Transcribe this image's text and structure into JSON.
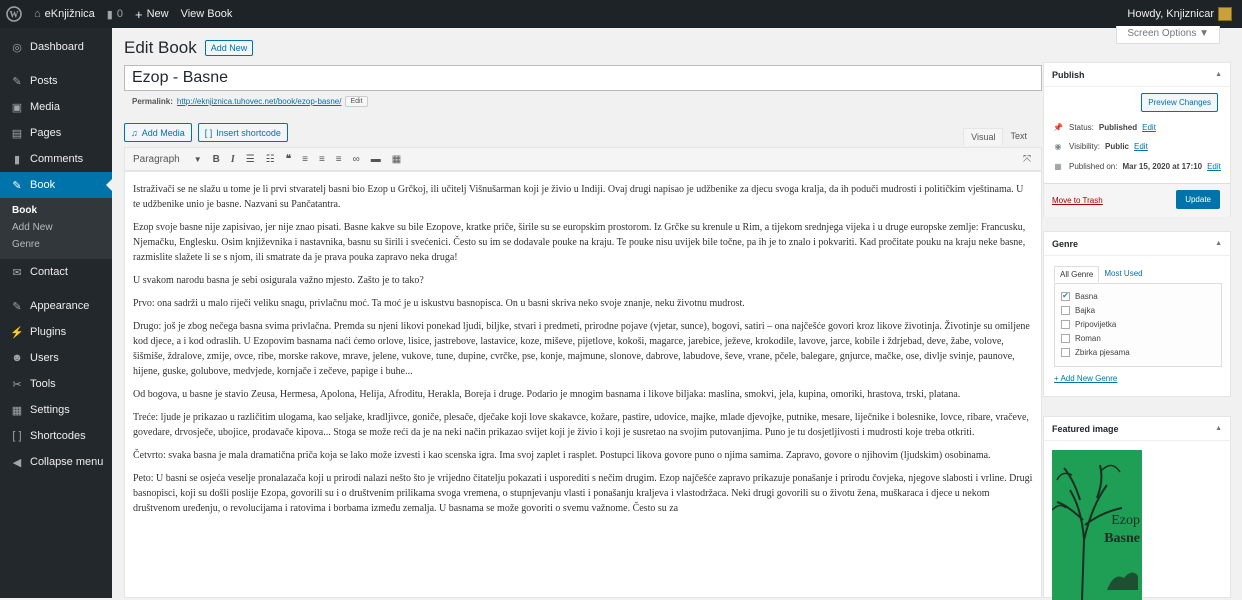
{
  "adminbar": {
    "site_name": "eKnjižnica",
    "comments_count": "0",
    "new_label": "New",
    "view_label": "View Book",
    "howdy": "Howdy, Knjiznicar"
  },
  "sidebar": {
    "items": [
      {
        "icon": "dashboard-icon",
        "glyph": "◎",
        "label": "Dashboard"
      },
      {
        "icon": "pin-icon",
        "glyph": "✎",
        "label": "Posts"
      },
      {
        "icon": "media-icon",
        "glyph": "▣",
        "label": "Media"
      },
      {
        "icon": "pages-icon",
        "glyph": "▤",
        "label": "Pages"
      },
      {
        "icon": "comments-icon",
        "glyph": "▮",
        "label": "Comments"
      },
      {
        "icon": "book-icon",
        "glyph": "✎",
        "label": "Book"
      }
    ],
    "submenu": [
      "Book",
      "Add New",
      "Genre"
    ],
    "items2": [
      {
        "icon": "contact-icon",
        "glyph": "✉",
        "label": "Contact"
      },
      {
        "icon": "appearance-icon",
        "glyph": "✎",
        "label": "Appearance"
      },
      {
        "icon": "plugins-icon",
        "glyph": "⚡",
        "label": "Plugins"
      },
      {
        "icon": "users-icon",
        "glyph": "☻",
        "label": "Users"
      },
      {
        "icon": "tools-icon",
        "glyph": "✂",
        "label": "Tools"
      },
      {
        "icon": "settings-icon",
        "glyph": "▦",
        "label": "Settings"
      },
      {
        "icon": "shortcodes-icon",
        "glyph": "[ ]",
        "label": "Shortcodes"
      },
      {
        "icon": "collapse-icon",
        "glyph": "◀",
        "label": "Collapse menu"
      }
    ]
  },
  "header": {
    "title": "Edit Book",
    "add_new": "Add New",
    "screen_options": "Screen Options ▼"
  },
  "editor": {
    "post_title": "Ezop - Basne",
    "permalink_label": "Permalink:",
    "permalink_url": "http://eknjiznica.tuhovec.net/book/ezop-basne/",
    "edit_label": "Edit",
    "add_media": "Add Media",
    "insert_shortcode": "Insert shortcode",
    "tab_visual": "Visual",
    "tab_text": "Text",
    "format_select": "Paragraph",
    "paragraphs": [
      "Istraživači se ne slažu u tome je li prvi stvaratelj basni bio Ezop u Grčkoj, ili učitelj Višnušarman koji je živio u Indiji. Ovaj drugi napisao je udžbenike za djecu svoga kralja, da ih poduči mudrosti i političkim vještinama. U te udžbenike unio je basne. Nazvani su Pančatantra.",
      "Ezop svoje basne nije zapisivao, jer nije znao pisati. Basne kakve su bile Ezopove, kratke priče, širile su se europskim prostorom. Iz Grčke su krenule u Rim, a tijekom srednjega vijeka i u druge europske zemlje: Francusku, Njemačku, Englesku. Osim književnika i nastavnika, basnu su širili i svećenici. Često su im se dodavale pouke na kraju. Te pouke nisu uvijek bile točne, pa ih je to znalo i pokvariti. Kad pročitate pouku na kraju neke basne, razmislite slažete li se s njom, ili smatrate da je prava pouka zapravo neka druga!",
      "U svakom narodu basna je sebi osigurala važno mjesto. Zašto je to tako?",
      "Prvo: ona sadrži u malo riječi veliku snagu, privlačnu moć. Ta moć je u iskustvu basnopisca. On u basni skriva neko svoje znanje, neku životnu mudrost.",
      "Drugo: još je zbog nečega basna svima privlačna. Premda su njeni likovi ponekad ljudi, biljke, stvari i predmeti, prirodne pojave (vjetar, sunce), bogovi, satiri – ona najčešće govori kroz likove životinja. Životinje su omiljene kod djece, a i kod odraslih. U Ezopovim basnama naći ćemo orlove, lisice, jastrebove, lastavice, koze, miševe, pijetlove, kokoši, magarce, jarebice, ježeve, krokodile, lavove, jarce, kobile i ždrjebad, deve, žabe, volove, šišmiše, ždralove, zmije, ovce, ribe, morske rakove, mrave, jelene, vukove, tune, dupine, cvrčke, pse, konje, majmune, slonove, dabrove, labudove, ševe, vrane, pčele, balegare, gnjurce, mačke, ose, divlje svinje, paunove, hijene, guske, golubove, medvjede, kornjače i zečeve, papige i buhe...",
      "Od bogova, u basne je stavio Zeusa, Hermesa, Apolona, Helija, Afroditu, Herakla, Boreja i druge. Podario je mnogim basnama i likove biljaka: maslina, smokvi, jela, kupina, omoriki, hrastova, trski, platana.",
      "Treće: ljude je prikazao u različitim ulogama, kao seljake, kradljivce, goniče, plesače, dječake koji love skakavce, kožare, pastire, udovice, majke, mlade djevojke, putnike, mesare, liječnike i bolesnike, lovce, ribare, vračeve, govedare, drvosječe, ubojice, prodavače kipova... Stoga se može reći da je na neki način prikazao svijet koji je živio i koji je susretao na svojim putovanjima. Puno je tu dosjetljivosti i mudrosti koje treba otkriti.",
      "Četvrto: svaka basna je mala dramatična priča koja se lako može izvesti i kao scenska igra. Ima svoj zaplet i rasplet. Postupci likova govore puno o njima samima. Zapravo, govore o njihovim (ljudskim) osobinama.",
      "Peto: U basni se osjeća veselje pronalazača koji u prirodi nalazi nešto što je vrijedno čitatelju pokazati i usporediti s nečim drugim. Ezop najčešće zapravo prikazuje ponašanje i prirodu čovjeka, njegove slabosti i vrline. Drugi basnopisci, koji su došli poslije Ezopa, govorili su i o društvenim prilikama svoga vremena, o stupnjevanju vlasti i ponašanju kraljeva i vlastodržaca. Neki drugi govorili su o životu žena, muškaraca i djece u nekom društvenom uređenju, o revolucijama i ratovima i borbama između zemalja. U basnama se može govoriti o svemu važnome. Često su za"
    ]
  },
  "publish": {
    "title": "Publish",
    "preview": "Preview Changes",
    "status_label": "Status:",
    "status_value": "Published",
    "visibility_label": "Visibility:",
    "visibility_value": "Public",
    "published_label": "Published on:",
    "published_value": "Mar 15, 2020 at 17:10",
    "edit": "Edit",
    "trash": "Move to Trash",
    "update": "Update"
  },
  "genre": {
    "title": "Genre",
    "tab_all": "All Genre",
    "tab_used": "Most Used",
    "items": [
      {
        "label": "Basna",
        "checked": true
      },
      {
        "label": "Bajka",
        "checked": false
      },
      {
        "label": "Pripovijetka",
        "checked": false
      },
      {
        "label": "Roman",
        "checked": false
      },
      {
        "label": "Zbirka pjesama",
        "checked": false
      }
    ],
    "add_new": "+ Add New Genre"
  },
  "featured": {
    "title": "Featured image",
    "cover_title": "Ezop",
    "cover_subtitle": "Basne",
    "cover_color": "#1f9e55"
  }
}
